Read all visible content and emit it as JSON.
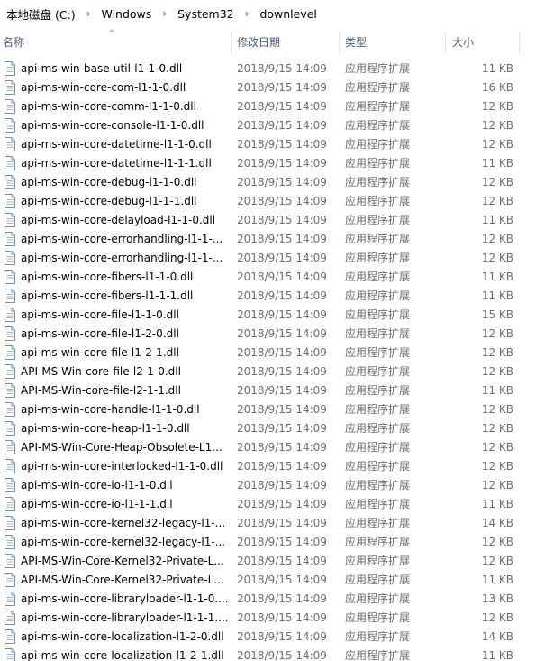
{
  "breadcrumb": {
    "items": [
      "本地磁盘 (C:)",
      "Windows",
      "System32",
      "downlevel"
    ],
    "separator": "›"
  },
  "columns": {
    "name": "名称",
    "date": "修改日期",
    "type": "类型",
    "size": "大小",
    "sort_indicator": "^"
  },
  "files": [
    {
      "name": "api-ms-win-base-util-l1-1-0.dll",
      "date": "2018/9/15 14:09",
      "type": "应用程序扩展",
      "size": "11 KB"
    },
    {
      "name": "api-ms-win-core-com-l1-1-0.dll",
      "date": "2018/9/15 14:09",
      "type": "应用程序扩展",
      "size": "16 KB"
    },
    {
      "name": "api-ms-win-core-comm-l1-1-0.dll",
      "date": "2018/9/15 14:09",
      "type": "应用程序扩展",
      "size": "12 KB"
    },
    {
      "name": "api-ms-win-core-console-l1-1-0.dll",
      "date": "2018/9/15 14:09",
      "type": "应用程序扩展",
      "size": "12 KB"
    },
    {
      "name": "api-ms-win-core-datetime-l1-1-0.dll",
      "date": "2018/9/15 14:09",
      "type": "应用程序扩展",
      "size": "12 KB"
    },
    {
      "name": "api-ms-win-core-datetime-l1-1-1.dll",
      "date": "2018/9/15 14:09",
      "type": "应用程序扩展",
      "size": "11 KB"
    },
    {
      "name": "api-ms-win-core-debug-l1-1-0.dll",
      "date": "2018/9/15 14:09",
      "type": "应用程序扩展",
      "size": "12 KB"
    },
    {
      "name": "api-ms-win-core-debug-l1-1-1.dll",
      "date": "2018/9/15 14:09",
      "type": "应用程序扩展",
      "size": "12 KB"
    },
    {
      "name": "api-ms-win-core-delayload-l1-1-0.dll",
      "date": "2018/9/15 14:09",
      "type": "应用程序扩展",
      "size": "11 KB"
    },
    {
      "name": "api-ms-win-core-errorhandling-l1-1-...",
      "date": "2018/9/15 14:09",
      "type": "应用程序扩展",
      "size": "12 KB"
    },
    {
      "name": "api-ms-win-core-errorhandling-l1-1-...",
      "date": "2018/9/15 14:09",
      "type": "应用程序扩展",
      "size": "12 KB"
    },
    {
      "name": "api-ms-win-core-fibers-l1-1-0.dll",
      "date": "2018/9/15 14:09",
      "type": "应用程序扩展",
      "size": "11 KB"
    },
    {
      "name": "api-ms-win-core-fibers-l1-1-1.dll",
      "date": "2018/9/15 14:09",
      "type": "应用程序扩展",
      "size": "11 KB"
    },
    {
      "name": "api-ms-win-core-file-l1-1-0.dll",
      "date": "2018/9/15 14:09",
      "type": "应用程序扩展",
      "size": "15 KB"
    },
    {
      "name": "api-ms-win-core-file-l1-2-0.dll",
      "date": "2018/9/15 14:09",
      "type": "应用程序扩展",
      "size": "12 KB"
    },
    {
      "name": "api-ms-win-core-file-l1-2-1.dll",
      "date": "2018/9/15 14:09",
      "type": "应用程序扩展",
      "size": "12 KB"
    },
    {
      "name": "API-MS-Win-core-file-l2-1-0.dll",
      "date": "2018/9/15 14:09",
      "type": "应用程序扩展",
      "size": "12 KB"
    },
    {
      "name": "API-MS-Win-core-file-l2-1-1.dll",
      "date": "2018/9/15 14:09",
      "type": "应用程序扩展",
      "size": "11 KB"
    },
    {
      "name": "api-ms-win-core-handle-l1-1-0.dll",
      "date": "2018/9/15 14:09",
      "type": "应用程序扩展",
      "size": "12 KB"
    },
    {
      "name": "api-ms-win-core-heap-l1-1-0.dll",
      "date": "2018/9/15 14:09",
      "type": "应用程序扩展",
      "size": "12 KB"
    },
    {
      "name": "API-MS-Win-Core-Heap-Obsolete-L1...",
      "date": "2018/9/15 14:09",
      "type": "应用程序扩展",
      "size": "12 KB"
    },
    {
      "name": "api-ms-win-core-interlocked-l1-1-0.dll",
      "date": "2018/9/15 14:09",
      "type": "应用程序扩展",
      "size": "12 KB"
    },
    {
      "name": "api-ms-win-core-io-l1-1-0.dll",
      "date": "2018/9/15 14:09",
      "type": "应用程序扩展",
      "size": "12 KB"
    },
    {
      "name": "api-ms-win-core-io-l1-1-1.dll",
      "date": "2018/9/15 14:09",
      "type": "应用程序扩展",
      "size": "11 KB"
    },
    {
      "name": "api-ms-win-core-kernel32-legacy-l1-...",
      "date": "2018/9/15 14:09",
      "type": "应用程序扩展",
      "size": "14 KB"
    },
    {
      "name": "api-ms-win-core-kernel32-legacy-l1-...",
      "date": "2018/9/15 14:09",
      "type": "应用程序扩展",
      "size": "12 KB"
    },
    {
      "name": "API-MS-Win-Core-Kernel32-Private-L...",
      "date": "2018/9/15 14:09",
      "type": "应用程序扩展",
      "size": "12 KB"
    },
    {
      "name": "API-MS-Win-Core-Kernel32-Private-L...",
      "date": "2018/9/15 14:09",
      "type": "应用程序扩展",
      "size": "11 KB"
    },
    {
      "name": "api-ms-win-core-libraryloader-l1-1-0....",
      "date": "2018/9/15 14:09",
      "type": "应用程序扩展",
      "size": "13 KB"
    },
    {
      "name": "api-ms-win-core-libraryloader-l1-1-1....",
      "date": "2018/9/15 14:09",
      "type": "应用程序扩展",
      "size": "12 KB"
    },
    {
      "name": "api-ms-win-core-localization-l1-2-0.dll",
      "date": "2018/9/15 14:09",
      "type": "应用程序扩展",
      "size": "14 KB"
    },
    {
      "name": "api-ms-win-core-localization-l1-2-1.dll",
      "date": "2018/9/15 14:09",
      "type": "应用程序扩展",
      "size": "11 KB"
    }
  ]
}
